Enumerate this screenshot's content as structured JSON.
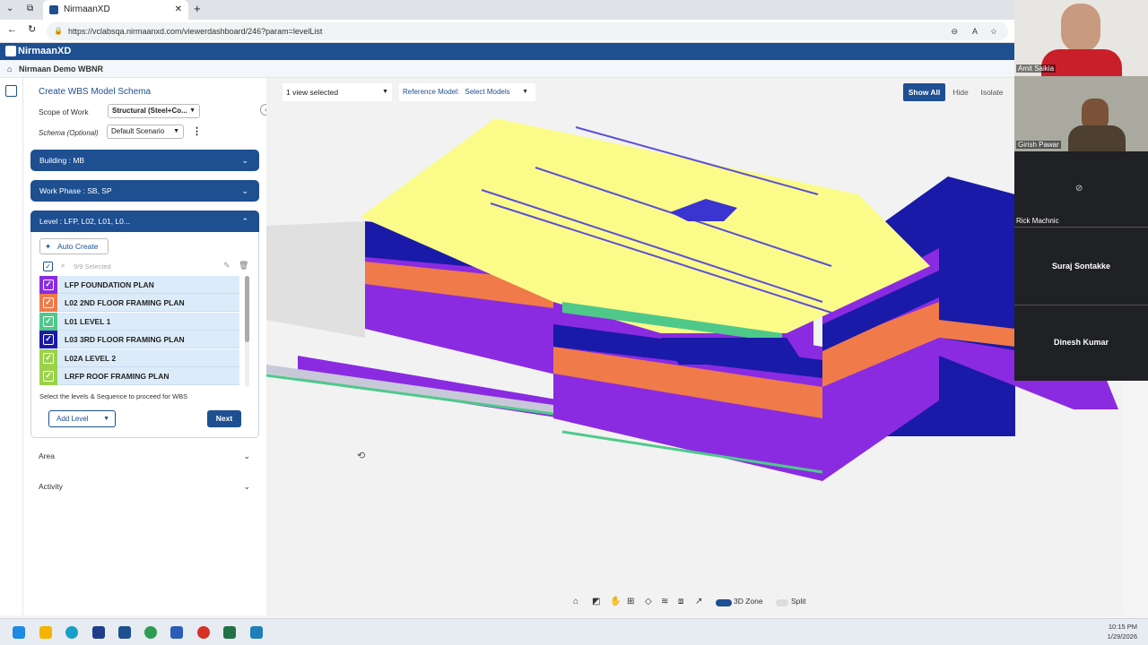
{
  "browser": {
    "tab_title": "NirmaanXD",
    "url": "https://vclabsqa.nirmaanxd.com/viewerdashboard/246?param=levelList"
  },
  "app": {
    "brand": "NirmaanXD",
    "breadcrumb": "Nirmaan Demo WBNR"
  },
  "panel": {
    "title": "Create WBS Model Schema",
    "scope_label": "Scope of Work",
    "scope_value": "Structural (Steel+Co...",
    "schema_label": "Schema (Optional)",
    "schema_value": "Default Scenario",
    "building": "Building : MB",
    "work_phase": "Work Phase : SB, SP",
    "level": "Level : LFP, L02, L01, L0...",
    "auto_create": "Auto Create",
    "selected_count": "9/9 Selected",
    "levels": [
      {
        "label": "LFP FOUNDATION PLAN",
        "color": "#8a2be2"
      },
      {
        "label": "L02 2ND FLOOR FRAMING PLAN",
        "color": "#f07a4a"
      },
      {
        "label": "L01 LEVEL 1",
        "color": "#4fc98a"
      },
      {
        "label": "L03 3RD FLOOR FRAMING PLAN",
        "color": "#1a1aa8"
      },
      {
        "label": "L02A LEVEL 2",
        "color": "#9ad34a"
      },
      {
        "label": "LRFP ROOF FRAMING PLAN",
        "color": "#9ad34a"
      }
    ],
    "hint": "Select the levels & Sequence to proceed for WBS",
    "add_level": "Add Level",
    "next": "Next",
    "area": "Area",
    "activity": "Activity"
  },
  "viewer": {
    "view_selected": "1 view selected",
    "reference_label": "Reference Model:",
    "reference_value": "Select Models",
    "show_all": "Show All",
    "hide": "Hide",
    "isolate": "Isolate",
    "zone": "3D Zone",
    "split": "Split"
  },
  "participants": [
    {
      "name": "Amit Saikia"
    },
    {
      "name": "Girish Pawar"
    },
    {
      "name": "Rick Machnic"
    },
    {
      "name": "Suraj Sontakke"
    },
    {
      "name": "Dinesh Kumar"
    }
  ],
  "clock": {
    "time": "10:15 PM",
    "date": "1/29/2026"
  }
}
